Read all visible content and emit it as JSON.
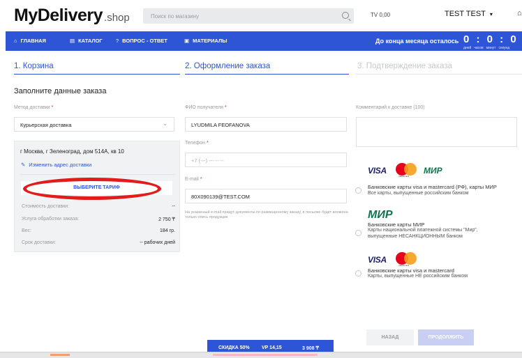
{
  "header": {
    "logo_main": "MyDelivery",
    "logo_suffix": ".shop",
    "search_placeholder": "Поиск по магазину",
    "balance": "TV 0,00",
    "user_name": "TEST TEST"
  },
  "nav": {
    "items": [
      {
        "label": "ГЛАВНАЯ",
        "icon": "home-icon",
        "glyph": "⌂"
      },
      {
        "label": "КАТАЛОГ",
        "icon": "catalog-icon",
        "glyph": "▤"
      },
      {
        "label": "ВОПРОС - ОТВЕТ",
        "icon": "question-icon",
        "glyph": "?"
      },
      {
        "label": "МАТЕРИАЛЫ",
        "icon": "materials-icon",
        "glyph": "▣"
      }
    ],
    "countdown_label": "До конца месяца осталось",
    "countdown_digits": "0 : 0 : 0 : 0",
    "countdown_units": [
      "дней",
      "часов",
      "минут",
      "секунд"
    ]
  },
  "steps": [
    {
      "label": "1. Корзина",
      "state": "done"
    },
    {
      "label": "2. Оформление заказа",
      "state": "active"
    },
    {
      "label": "3. Подтверждение заказа",
      "state": "pending"
    }
  ],
  "form": {
    "title": "Заполните данные заказа",
    "delivery_method_label": "Метод доставки",
    "delivery_method_value": "Курьерская доставка",
    "address": "г Москва, г Зеленоград, дом 514А, кв 10",
    "change_address": "Изменить адрес доставки",
    "choose_tariff": "ВЫБЕРИТЕ ТАРИФ",
    "cost_rows": [
      {
        "label": "Стоимость доставки:",
        "value": "--"
      },
      {
        "label": "Услуга обработки заказа:",
        "value": "2 750 ₸"
      },
      {
        "label": "Вес:",
        "value": "184 гр."
      },
      {
        "label": "Срок доставки:",
        "value": "-- рабочих дней"
      }
    ],
    "recipient_label": "ФИО получателя",
    "recipient_value": "LYUDMILA FEOFANOVA",
    "phone_label": "Телефон",
    "phone_placeholder": "+7 (---) --- -- --",
    "email_label": "E-mail",
    "email_value": "80X090139@TEST.COM",
    "email_note": "На указанный e-mail придут документы по размещенному заказу, в посылке будет вложена только опись продукции",
    "comment_label": "Комментарий к доставке (100)",
    "required_mark": "*"
  },
  "payment": {
    "options": [
      {
        "title": "Банковские карты visa и mastercard (РФ), карты МИР",
        "subtitle": "Все карты, выпущенные российским банком"
      },
      {
        "title": "Банковские карты МИР",
        "subtitle": "Карты национальной платежной системы \"Мир\",",
        "subtitle2": "выпущенные НЕСАНКЦИОННЫМ банком"
      },
      {
        "title": "Банковские карты visa и mastercard",
        "subtitle": "Карты, выпущенные НЕ российским банком"
      }
    ],
    "visa_logo": "VISA",
    "mir_logo": "МИР",
    "mastercard_caption": "mastercard"
  },
  "buttons": {
    "back": "НАЗАД",
    "next": "ПРОДОЛЖИТЬ"
  },
  "bottom_bar": {
    "discount": "СКИДКА 50%",
    "vp": "VP 14,15",
    "total": "3 908 ₸"
  },
  "colors": {
    "accent": "#2d55d6",
    "highlight_oval": "#e21c1c"
  }
}
